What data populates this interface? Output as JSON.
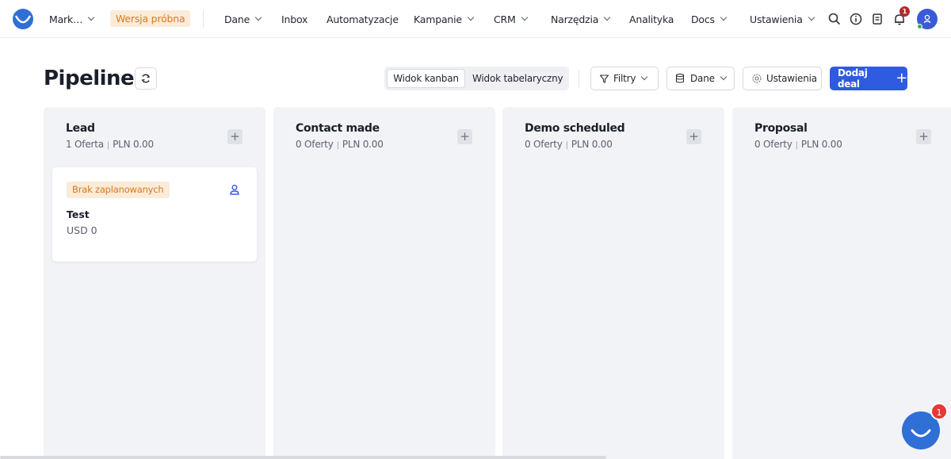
{
  "nav": {
    "account_label": "Mark…",
    "trial_label": "Wersja próbna",
    "items": [
      {
        "label": "Dane",
        "dropdown": true
      },
      {
        "label": "Inbox",
        "dropdown": false
      },
      {
        "label": "Automatyzacje",
        "dropdown": false
      },
      {
        "label": "Kampanie",
        "dropdown": true
      },
      {
        "label": "CRM",
        "dropdown": true
      },
      {
        "label": "Narzędzia",
        "dropdown": true
      },
      {
        "label": "Analityka",
        "dropdown": false
      },
      {
        "label": "Docs",
        "dropdown": true
      },
      {
        "label": "Ustawienia",
        "dropdown": true
      }
    ],
    "icons": [
      "search-icon",
      "info-icon",
      "book-icon",
      "bell-icon",
      "user-avatar"
    ],
    "notification_count": "1"
  },
  "header": {
    "title": "Pipeline",
    "view_kanban": "Widok kanban",
    "view_table": "Widok tabelaryczny",
    "filters_label": "Filtry",
    "data_label": "Dane",
    "settings_label": "Ustawienia",
    "add_deal_label": "Dodaj deal"
  },
  "columns": [
    {
      "title": "Lead",
      "count": "1 Oferta",
      "amount": "PLN 0.00"
    },
    {
      "title": "Contact made",
      "count": "0 Oferty",
      "amount": "PLN 0.00"
    },
    {
      "title": "Demo scheduled",
      "count": "0 Oferty",
      "amount": "PLN 0.00"
    },
    {
      "title": "Proposal",
      "count": "0 Oferty",
      "amount": "PLN 0.00"
    }
  ],
  "deal_card": {
    "badge": "Brak zaplanowanych",
    "name": "Test",
    "value": "USD 0"
  },
  "chat": {
    "badge": "1"
  },
  "colors": {
    "accent": "#2f5be0",
    "trial_bg": "#fcebd8",
    "trial_text": "#d97a1e",
    "column_bg": "#f2f3f6",
    "badge_red": "#e53935"
  }
}
